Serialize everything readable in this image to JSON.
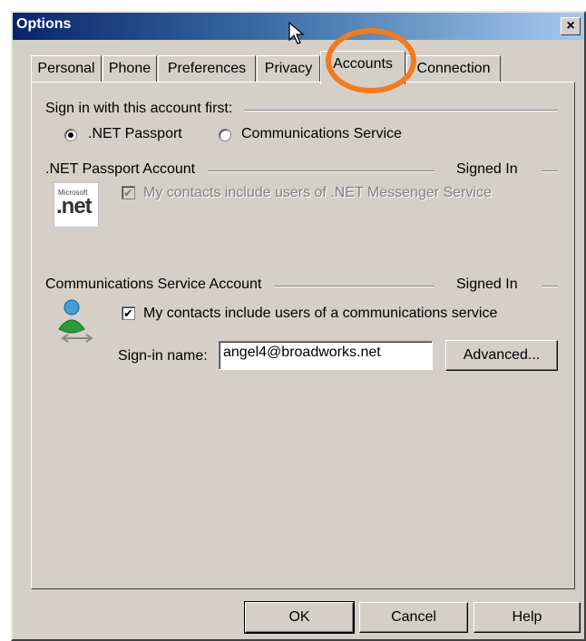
{
  "window": {
    "title": "Options",
    "close_glyph": "×"
  },
  "tabs": [
    {
      "label": "Personal"
    },
    {
      "label": "Phone"
    },
    {
      "label": "Preferences"
    },
    {
      "label": "Privacy"
    },
    {
      "label": "Accounts",
      "active": true
    },
    {
      "label": "Connection"
    }
  ],
  "signin": {
    "group_label": "Sign in with this account first:",
    "options": [
      {
        "label": ".NET Passport",
        "selected": true
      },
      {
        "label": "Communications Service",
        "selected": false
      }
    ]
  },
  "passport": {
    "group_label": ".NET Passport Account",
    "status": "Signed In",
    "logo_small": "Microsoft",
    "logo_text": ".net",
    "checkbox_label": "My contacts include users of .NET Messenger Service",
    "checked": true,
    "disabled": true
  },
  "comm": {
    "group_label": "Communications Service Account",
    "status": "Signed In",
    "icon": "messenger-buddy-icon",
    "checkbox_label": "My contacts include users of a communications service",
    "checked": true,
    "signin_label": "Sign-in name:",
    "signin_value": "angel4@broadworks.net",
    "advanced_label": "Advanced..."
  },
  "footer": {
    "ok": "OK",
    "cancel": "Cancel",
    "help": "Help"
  },
  "colors": {
    "dialog": "#d4d0c8",
    "title_start": "#0a246a",
    "highlight": "#f47a20"
  }
}
